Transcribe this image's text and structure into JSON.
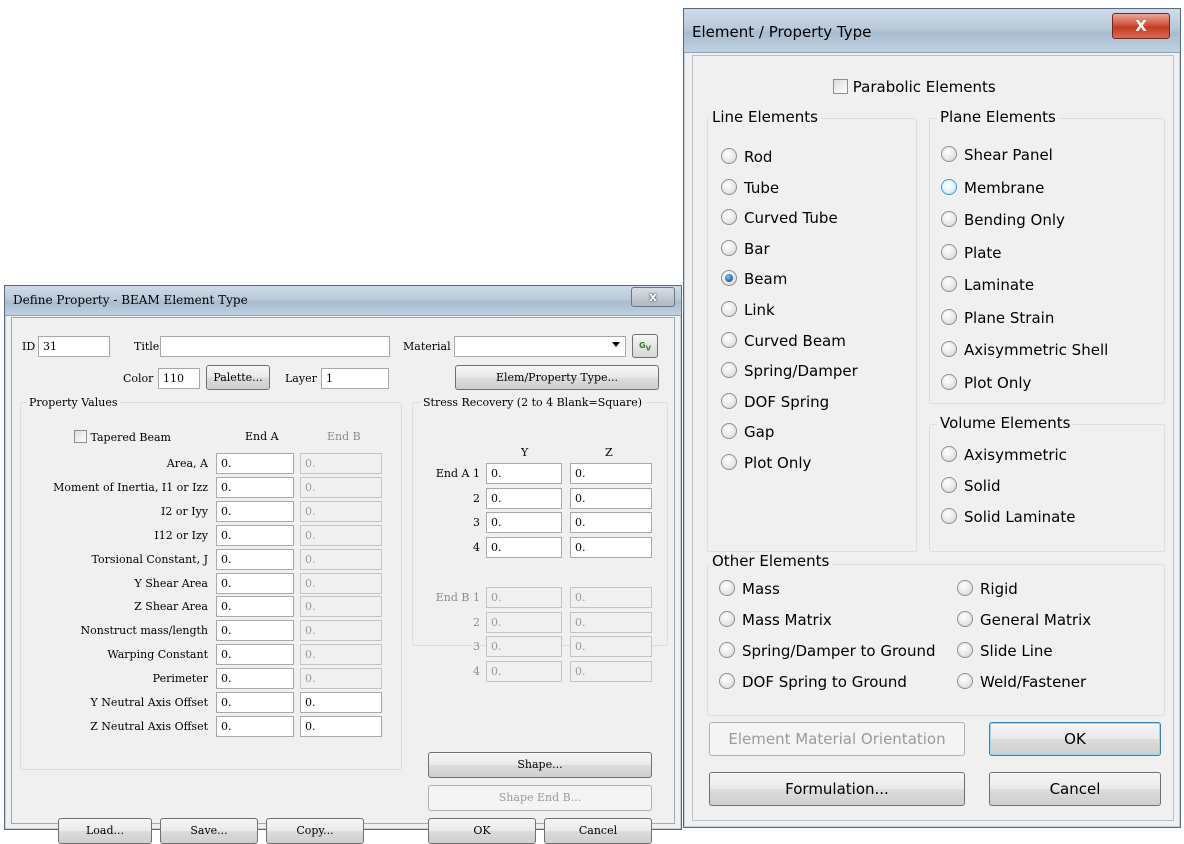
{
  "left_dialog": {
    "title": "Define Property - BEAM Element Type",
    "close_label": "x",
    "id_label": "ID",
    "id_value": "31",
    "title_label": "Title",
    "title_value": "",
    "material_label": "Material",
    "material_value": "",
    "color_label": "Color",
    "color_value": "110",
    "palette_button": "Palette...",
    "layer_label": "Layer",
    "layer_value": "1",
    "elem_property_button": "Elem/Property Type...",
    "property_values": {
      "group_label": "Property Values",
      "tapered_beam": "Tapered Beam",
      "end_a_header": "End A",
      "end_b_header": "End B",
      "rows": [
        {
          "label": "Area, A",
          "end_a": "0.",
          "end_b": "0."
        },
        {
          "label": "Moment of Inertia, I1 or Izz",
          "end_a": "0.",
          "end_b": "0."
        },
        {
          "label": "I2 or Iyy",
          "end_a": "0.",
          "end_b": "0."
        },
        {
          "label": "I12 or Izy",
          "end_a": "0.",
          "end_b": "0."
        },
        {
          "label": "Torsional Constant, J",
          "end_a": "0.",
          "end_b": "0."
        },
        {
          "label": "Y Shear Area",
          "end_a": "0.",
          "end_b": "0."
        },
        {
          "label": "Z Shear Area",
          "end_a": "0.",
          "end_b": "0."
        },
        {
          "label": "Nonstruct mass/length",
          "end_a": "0.",
          "end_b": "0."
        },
        {
          "label": "Warping Constant",
          "end_a": "0.",
          "end_b": "0."
        },
        {
          "label": "Perimeter",
          "end_a": "0.",
          "end_b": "0."
        },
        {
          "label": "Y Neutral Axis Offset",
          "end_a": "0.",
          "end_b": "0."
        },
        {
          "label": "Z Neutral Axis Offset",
          "end_a": "0.",
          "end_b": "0."
        }
      ]
    },
    "stress_recovery": {
      "group_label": "Stress Recovery (2 to 4 Blank=Square)",
      "y_header": "Y",
      "z_header": "Z",
      "end_a_rows": [
        {
          "label": "End A 1",
          "y": "0.",
          "z": "0."
        },
        {
          "label": "2",
          "y": "0.",
          "z": "0."
        },
        {
          "label": "3",
          "y": "0.",
          "z": "0."
        },
        {
          "label": "4",
          "y": "0.",
          "z": "0."
        }
      ],
      "end_b_rows": [
        {
          "label": "End B 1",
          "y": "0.",
          "z": "0."
        },
        {
          "label": "2",
          "y": "0.",
          "z": "0."
        },
        {
          "label": "3",
          "y": "0.",
          "z": "0."
        },
        {
          "label": "4",
          "y": "0.",
          "z": "0."
        }
      ]
    },
    "shape_button": "Shape...",
    "shape_end_b_button": "Shape End B...",
    "load_button": "Load...",
    "save_button": "Save...",
    "copy_button": "Copy...",
    "ok_button": "OK",
    "cancel_button": "Cancel"
  },
  "right_dialog": {
    "title": "Element / Property Type",
    "close_label": "X",
    "parabolic": "Parabolic Elements",
    "line_elements": {
      "label": "Line Elements",
      "items": [
        "Rod",
        "Tube",
        "Curved Tube",
        "Bar",
        "Beam",
        "Link",
        "Curved Beam",
        "Spring/Damper",
        "DOF Spring",
        "Gap",
        "Plot Only"
      ],
      "selected": "Beam"
    },
    "plane_elements": {
      "label": "Plane Elements",
      "items": [
        "Shear Panel",
        "Membrane",
        "Bending Only",
        "Plate",
        "Laminate",
        "Plane Strain",
        "Axisymmetric Shell",
        "Plot Only"
      ]
    },
    "volume_elements": {
      "label": "Volume Elements",
      "items": [
        "Axisymmetric",
        "Solid",
        "Solid Laminate"
      ]
    },
    "other_elements": {
      "label": "Other Elements",
      "left_items": [
        "Mass",
        "Mass Matrix",
        "Spring/Damper to Ground",
        "DOF Spring to Ground"
      ],
      "right_items": [
        "Rigid",
        "General Matrix",
        "Slide Line",
        "Weld/Fastener"
      ]
    },
    "element_material_orientation": "Element Material Orientation",
    "ok_button": "OK",
    "formulation_button": "Formulation...",
    "cancel_button": "Cancel"
  }
}
